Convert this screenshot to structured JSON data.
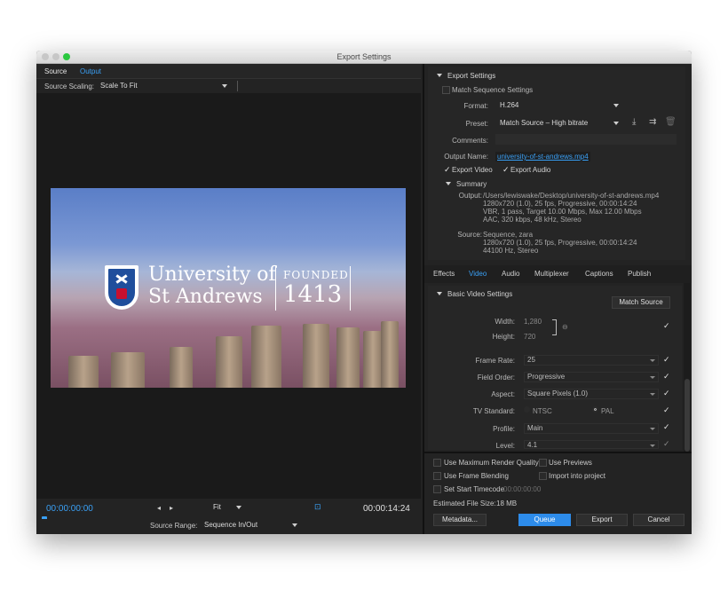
{
  "window": {
    "title": "Export Settings"
  },
  "left": {
    "tabs": [
      "Source",
      "Output"
    ],
    "source_scaling_label": "Source Scaling:",
    "source_scaling_value": "Scale To Fit",
    "preview": {
      "line1": "University of",
      "line2": "St Andrews",
      "founded": "FOUNDED",
      "year": "1413"
    },
    "timecode_start": "00:00:00:00",
    "timecode_end": "00:00:14:24",
    "fit_value": "Fit",
    "source_range_label": "Source Range:",
    "source_range_value": "Sequence In/Out"
  },
  "export_settings": {
    "header": "Export Settings",
    "match_sequence": "Match Sequence Settings",
    "format_label": "Format:",
    "format_value": "H.264",
    "preset_label": "Preset:",
    "preset_value": "Match Source – High bitrate",
    "comments_label": "Comments:",
    "output_name_label": "Output Name:",
    "output_name_value": "university-of-st-andrews.mp4",
    "export_video": "Export Video",
    "export_audio": "Export Audio",
    "summary_header": "Summary",
    "output_label": "Output:",
    "output_lines": [
      "/Users/lewiswake/Desktop/university-of-st-andrews.mp4",
      "1280x720 (1.0), 25 fps, Progressive, 00:00:14:24",
      "VBR, 1 pass, Target 10.00 Mbps, Max 12.00 Mbps",
      "AAC, 320 kbps, 48 kHz, Stereo"
    ],
    "source_label": "Source:",
    "source_lines": [
      "Sequence, zara",
      "1280x720 (1.0), 25 fps, Progressive, 00:00:14:24",
      "44100 Hz, Stereo"
    ]
  },
  "video_tabs": [
    "Effects",
    "Video",
    "Audio",
    "Multiplexer",
    "Captions",
    "Publish"
  ],
  "basic_video": {
    "header": "Basic Video Settings",
    "match_source": "Match Source",
    "width_label": "Width:",
    "width_value": "1,280",
    "height_label": "Height:",
    "height_value": "720",
    "frame_rate_label": "Frame Rate:",
    "frame_rate_value": "25",
    "field_order_label": "Field Order:",
    "field_order_value": "Progressive",
    "aspect_label": "Aspect:",
    "aspect_value": "Square Pixels (1.0)",
    "tv_standard_label": "TV Standard:",
    "ntsc": "NTSC",
    "pal": "PAL",
    "profile_label": "Profile:",
    "profile_value": "Main",
    "level_label": "Level:",
    "level_value": "4.1"
  },
  "bottom": {
    "max_render": "Use Maximum Render Quality",
    "use_previews": "Use Previews",
    "frame_blending": "Use Frame Blending",
    "import_project": "Import into project",
    "set_start_tc": "Set Start Timecode",
    "start_tc_value": "00:00:00:00",
    "est_size_label": "Estimated File Size:",
    "est_size_value": "18 MB",
    "metadata": "Metadata...",
    "queue": "Queue",
    "export": "Export",
    "cancel": "Cancel"
  },
  "colors": {
    "accent": "#2d8ceb",
    "link": "#3aa0f5"
  }
}
